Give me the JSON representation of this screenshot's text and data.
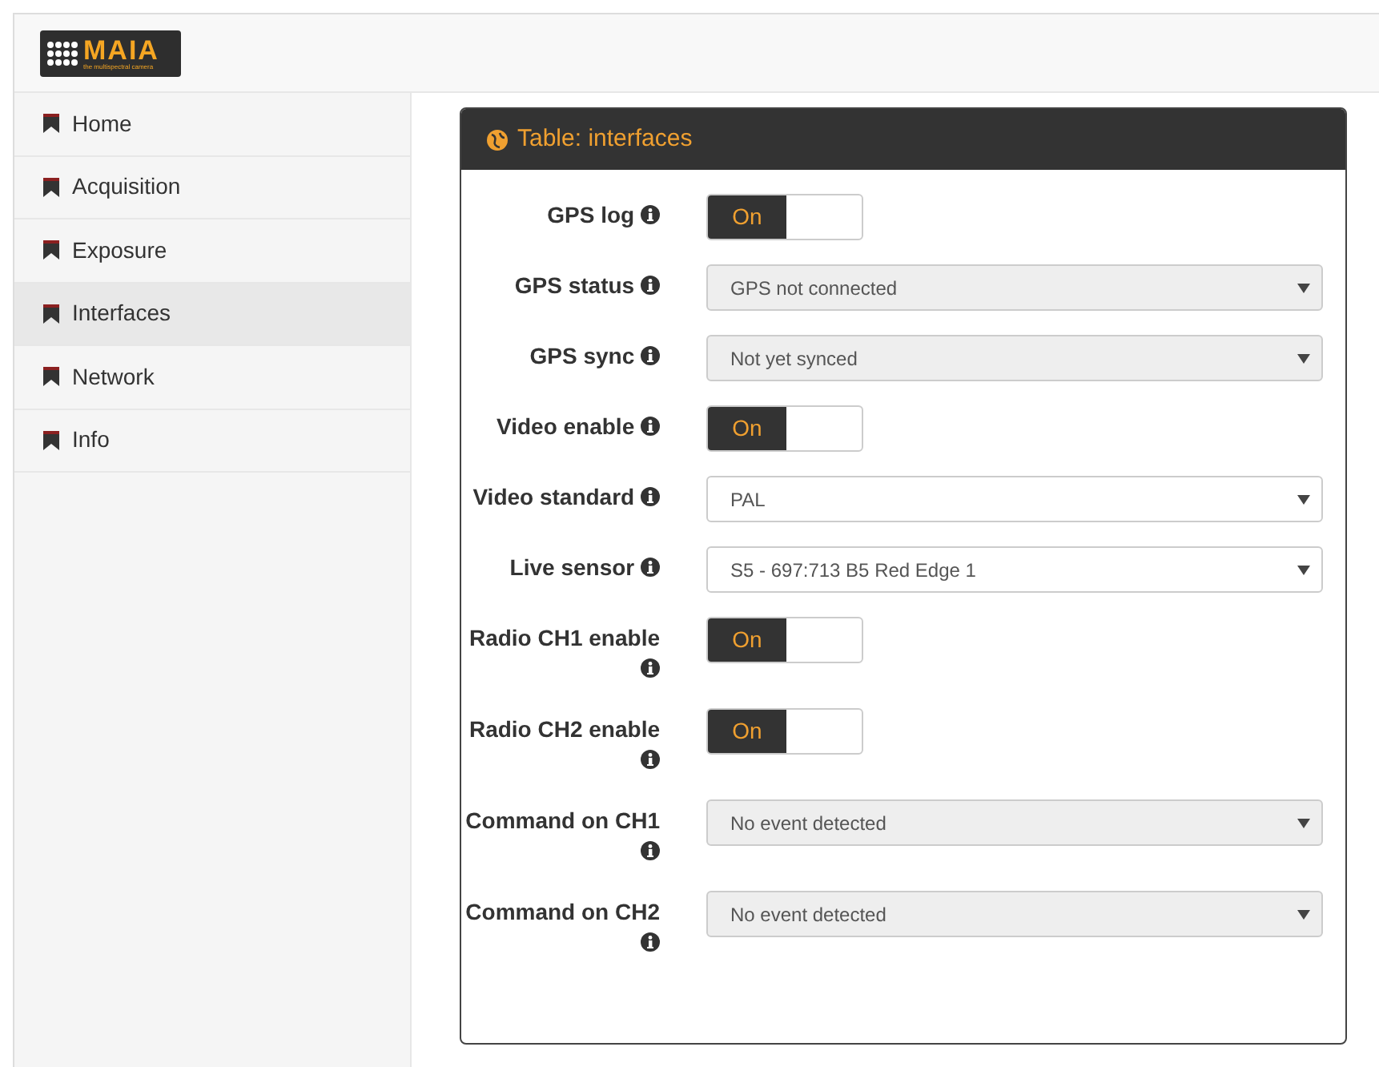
{
  "logo": {
    "name": "MAIA",
    "tagline": "the multispectral camera"
  },
  "sidebar": {
    "items": [
      {
        "label": "Home",
        "selected": false
      },
      {
        "label": "Acquisition",
        "selected": false
      },
      {
        "label": "Exposure",
        "selected": false
      },
      {
        "label": "Interfaces",
        "selected": true
      },
      {
        "label": "Network",
        "selected": false
      },
      {
        "label": "Info",
        "selected": false
      }
    ]
  },
  "panel": {
    "title": "Table: interfaces",
    "fields": [
      {
        "label": "GPS log",
        "kind": "toggle",
        "on": true,
        "text": "On"
      },
      {
        "label": "GPS status",
        "kind": "select",
        "disabled": true,
        "value": "GPS not connected"
      },
      {
        "label": "GPS sync",
        "kind": "select",
        "disabled": true,
        "value": "Not yet synced"
      },
      {
        "label": "Video enable",
        "kind": "toggle",
        "on": true,
        "text": "On"
      },
      {
        "label": "Video standard",
        "kind": "select",
        "disabled": false,
        "value": "PAL"
      },
      {
        "label": "Live sensor",
        "kind": "select",
        "disabled": false,
        "value": "S5 - 697:713 B5 Red Edge 1"
      },
      {
        "label": "Radio CH1 enable",
        "kind": "toggle",
        "on": true,
        "text": "On"
      },
      {
        "label": "Radio CH2 enable",
        "kind": "toggle",
        "on": true,
        "text": "On"
      },
      {
        "label": "Command on CH1",
        "kind": "select",
        "disabled": true,
        "value": "No event detected"
      },
      {
        "label": "Command on CH2",
        "kind": "select",
        "disabled": true,
        "value": "No event detected"
      }
    ]
  }
}
